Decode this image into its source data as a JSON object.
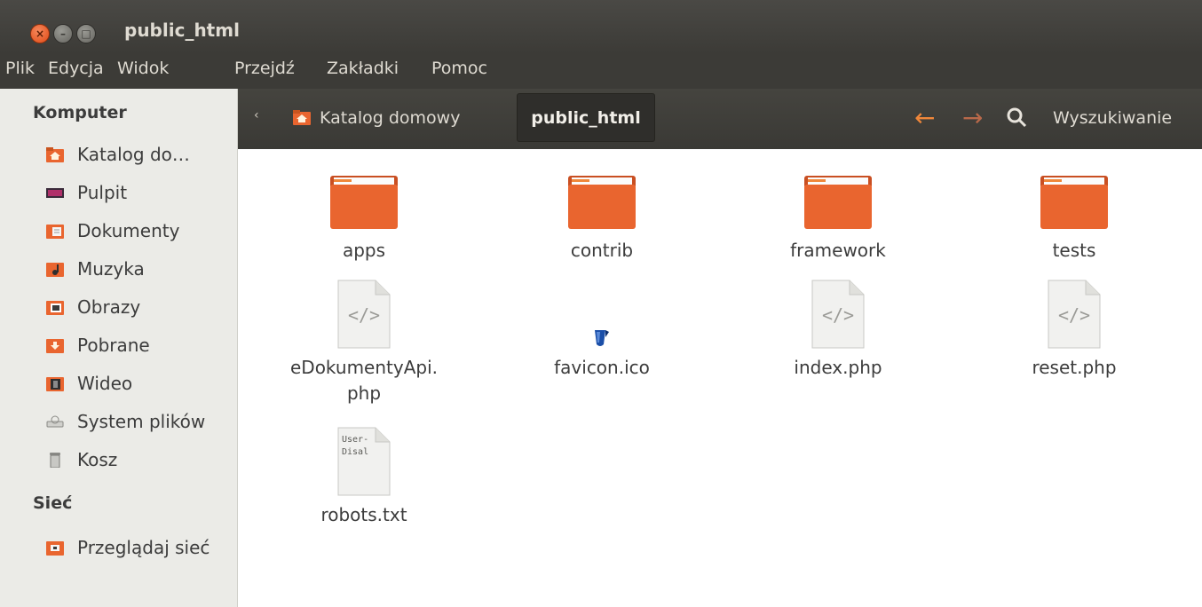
{
  "window": {
    "title": "public_html",
    "buttons": {
      "close": "×",
      "minimize": "–",
      "maximize": "□"
    }
  },
  "menubar": [
    "Plik",
    "Edycja",
    "Widok",
    "Przejdź",
    "Zakładki",
    "Pomoc"
  ],
  "sidebar": {
    "sections": [
      {
        "heading": "Komputer",
        "items": [
          {
            "label": "Katalog do…",
            "icon": "home-folder-icon"
          },
          {
            "label": "Pulpit",
            "icon": "desktop-icon"
          },
          {
            "label": "Dokumenty",
            "icon": "documents-folder-icon"
          },
          {
            "label": "Muzyka",
            "icon": "music-folder-icon"
          },
          {
            "label": "Obrazy",
            "icon": "pictures-folder-icon"
          },
          {
            "label": "Pobrane",
            "icon": "downloads-folder-icon"
          },
          {
            "label": "Wideo",
            "icon": "videos-folder-icon"
          },
          {
            "label": "System plików",
            "icon": "drive-icon"
          },
          {
            "label": "Kosz",
            "icon": "trash-icon"
          }
        ]
      },
      {
        "heading": "Sieć",
        "items": [
          {
            "label": "Przeglądaj sieć",
            "icon": "network-folder-icon"
          }
        ]
      }
    ]
  },
  "toolbar": {
    "breadcrumb_prev": "‹",
    "breadcrumb_home": "Katalog domowy",
    "breadcrumb_current": "public_html",
    "back": "←",
    "forward": "→",
    "search_label": "Wyszukiwanie"
  },
  "files": [
    {
      "name": "apps",
      "type": "folder"
    },
    {
      "name": "contrib",
      "type": "folder"
    },
    {
      "name": "framework",
      "type": "folder"
    },
    {
      "name": "tests",
      "type": "folder"
    },
    {
      "name": "eDokumentyApi.\nphp",
      "type": "code"
    },
    {
      "name": "favicon.ico",
      "type": "image"
    },
    {
      "name": "index.php",
      "type": "code"
    },
    {
      "name": "reset.php",
      "type": "code"
    },
    {
      "name": "robots.txt",
      "type": "text",
      "preview": [
        "User-",
        "Disal"
      ]
    }
  ],
  "colors": {
    "folder_orange": "#e9652f",
    "accent_orange": "#f0873a",
    "close_button": "#df4a16",
    "titlebar": "#3c3b37",
    "sidebar_bg": "#ebebe7"
  }
}
